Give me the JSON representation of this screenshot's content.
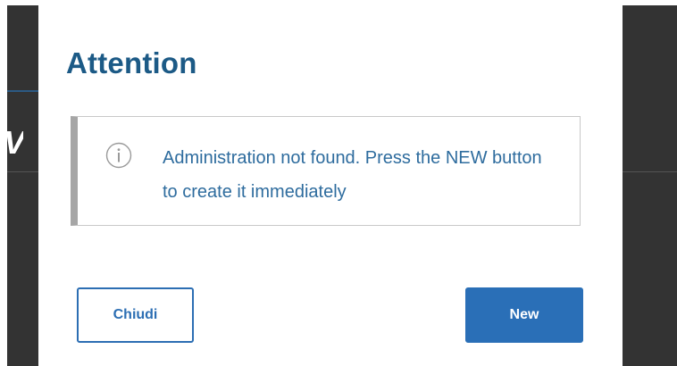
{
  "dialog": {
    "title": "Attention",
    "message": "Administration not found. Press the NEW button to create it immediately",
    "icon": "info-icon"
  },
  "buttons": {
    "close_label": "Chiudi",
    "new_label": "New"
  },
  "background": {
    "partial_glyph": "V"
  },
  "colors": {
    "title": "#1c5a86",
    "message": "#2e6c9e",
    "primary": "#2a6fb7",
    "overlay": "#333333",
    "info_accent": "#a6a6a6"
  }
}
